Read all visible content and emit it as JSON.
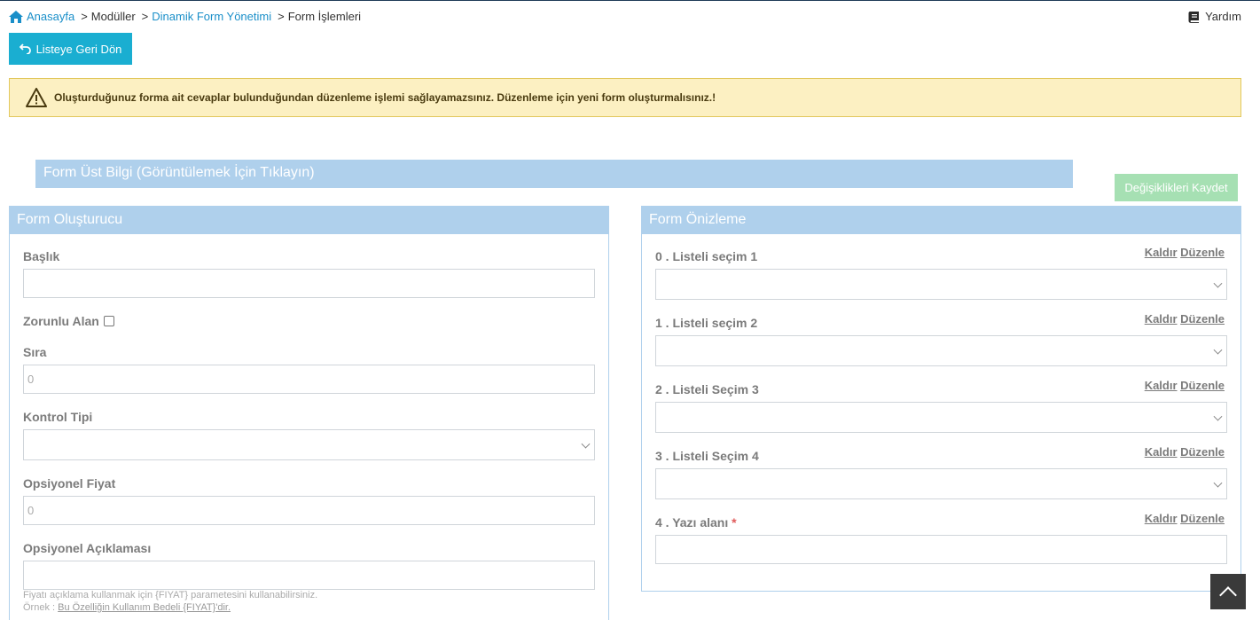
{
  "breadcrumb": {
    "home": "Anasayfa",
    "modules": "Modüller",
    "dynamic_form": "Dinamik Form Yönetimi",
    "form_ops": "Form İşlemleri"
  },
  "help_label": "Yardım",
  "back_button": "Listeye Geri Dön",
  "alert_text": "Oluşturduğunuz forma ait cevaplar bulunduğundan düzenleme işlemi sağlayamazsınız. Düzenleme için yeni form oluşturmalısınız.!",
  "form_header_bar": "Form Üst Bilgi (Görüntülemek İçin Tıklayın)",
  "save_button": "Değişiklikleri Kaydet",
  "builder": {
    "title": "Form Oluşturucu",
    "baslik_label": "Başlık",
    "baslik_value": "",
    "required_label": "Zorunlu Alan",
    "sira_label": "Sıra",
    "sira_placeholder": "0",
    "control_type_label": "Kontrol Tipi",
    "price_label": "Opsiyonel Fiyat",
    "price_placeholder": "0",
    "desc_label": "Opsiyonel Açıklaması",
    "hint_line1": "Fiyatı açıklama kullanmak için {FIYAT} parametesini kullanabilirsiniz.",
    "hint_prefix": "Örnek : ",
    "hint_example": "Bu Özelliğin Kullanım Bedeli {FIYAT}'dir."
  },
  "preview": {
    "title": "Form Önizleme",
    "remove_label": "Kaldır",
    "edit_label": "Düzenle",
    "items": [
      {
        "label": "0 . Listeli seçim 1",
        "type": "select"
      },
      {
        "label": "1 . Listeli seçim 2",
        "type": "select"
      },
      {
        "label": "2 . Listeli Seçim 3",
        "type": "select"
      },
      {
        "label": "3 . Listeli Seçim 4",
        "type": "select"
      },
      {
        "label": "4 . Yazı alanı",
        "type": "text",
        "required_mark": "*"
      }
    ]
  },
  "colors": {
    "accent": "#1aaed1",
    "panel_header": "#afd0ec",
    "save_button": "#a6e0b3",
    "alert_bg": "#fcf0c2"
  }
}
